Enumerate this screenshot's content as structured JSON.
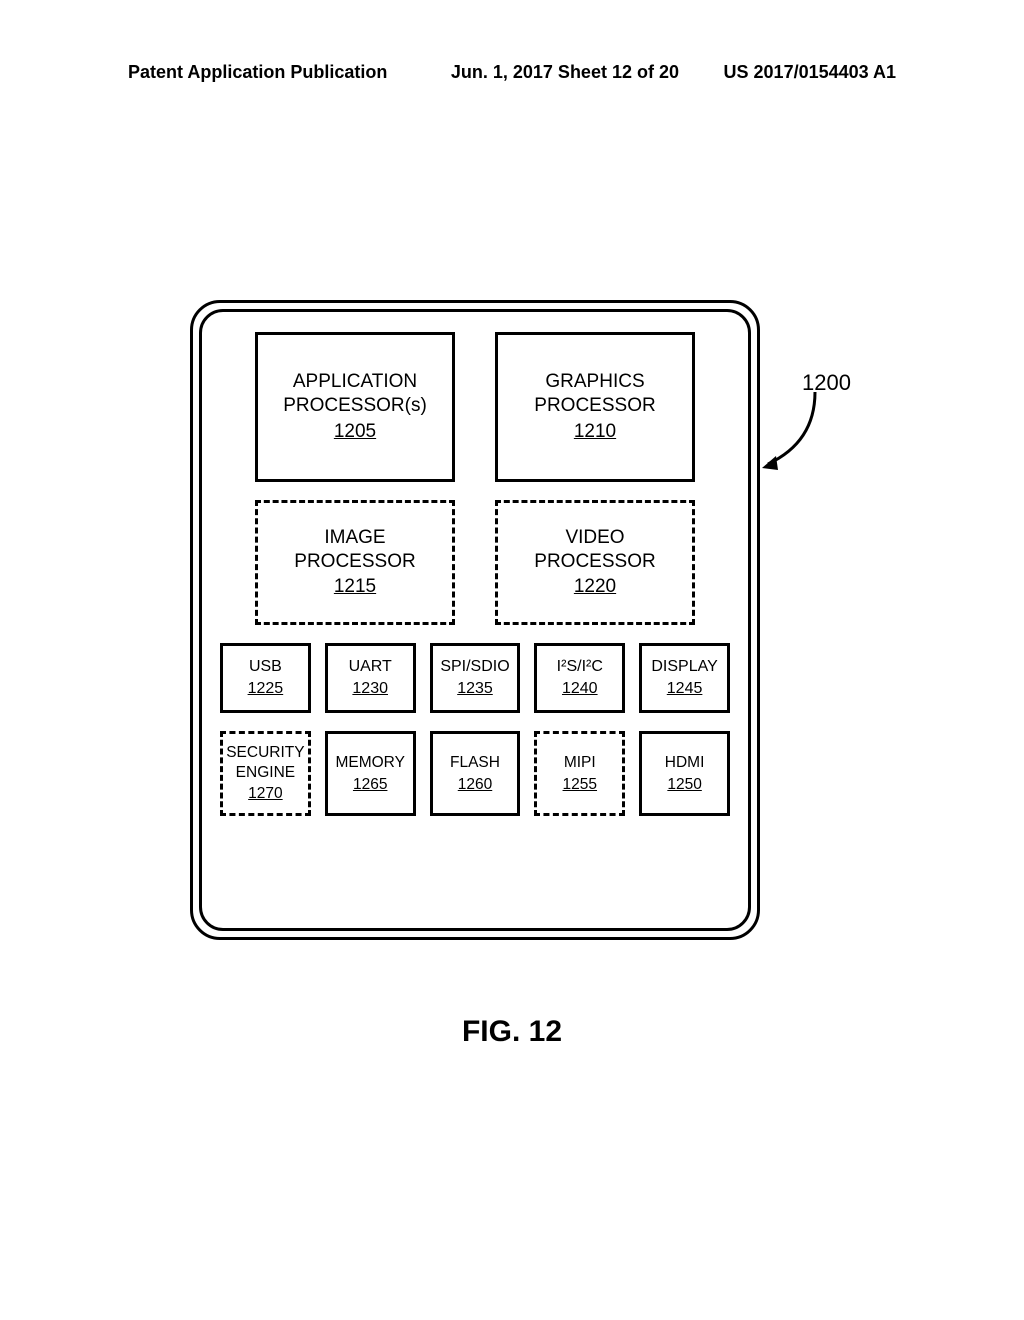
{
  "header": {
    "left": "Patent Application Publication",
    "mid": "Jun. 1, 2017  Sheet 12 of 20",
    "right": "US 2017/0154403 A1"
  },
  "chip_label": "1200",
  "blocks": {
    "app_proc": {
      "title1": "APPLICATION",
      "title2": "PROCESSOR(s)",
      "ref": "1205"
    },
    "gfx_proc": {
      "title1": "GRAPHICS",
      "title2": "PROCESSOR",
      "ref": "1210"
    },
    "img_proc": {
      "title1": "IMAGE",
      "title2": "PROCESSOR",
      "ref": "1215"
    },
    "vid_proc": {
      "title1": "VIDEO",
      "title2": "PROCESSOR",
      "ref": "1220"
    },
    "usb": {
      "title": "USB",
      "ref": "1225"
    },
    "uart": {
      "title": "UART",
      "ref": "1230"
    },
    "spi": {
      "title": "SPI/SDIO",
      "ref": "1235"
    },
    "i2s": {
      "title": "I²S/I²C",
      "ref": "1240"
    },
    "display": {
      "title": "DISPLAY",
      "ref": "1245"
    },
    "sec": {
      "title1": "SECURITY",
      "title2": "ENGINE",
      "ref": "1270"
    },
    "memory": {
      "title": "MEMORY",
      "ref": "1265"
    },
    "flash": {
      "title": "FLASH",
      "ref": "1260"
    },
    "mipi": {
      "title": "MIPI",
      "ref": "1255"
    },
    "hdmi": {
      "title": "HDMI",
      "ref": "1250"
    }
  },
  "caption": "FIG. 12"
}
